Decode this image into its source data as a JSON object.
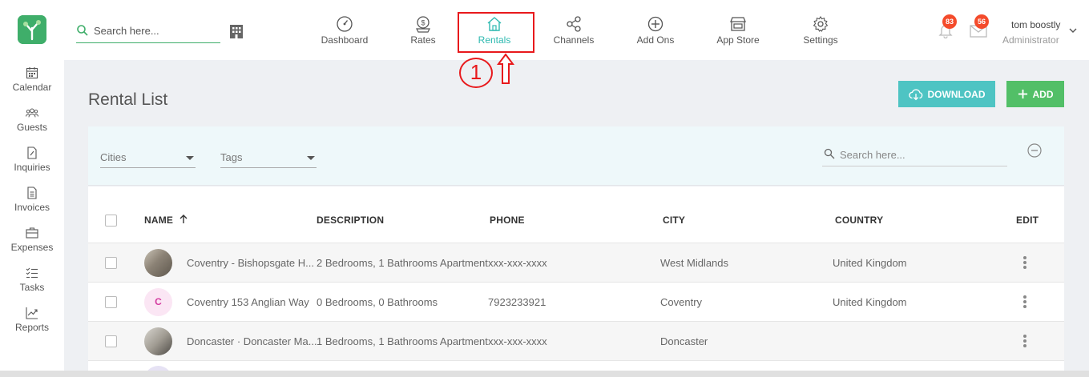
{
  "topbar": {
    "search_placeholder": "Search here...",
    "nav": [
      {
        "label": "Dashboard",
        "icon": "dashboard-icon"
      },
      {
        "label": "Rates",
        "icon": "rates-icon"
      },
      {
        "label": "Rentals",
        "icon": "home-icon",
        "active": true
      },
      {
        "label": "Channels",
        "icon": "share-icon"
      },
      {
        "label": "Add Ons",
        "icon": "plus-circle-icon"
      },
      {
        "label": "App Store",
        "icon": "store-icon"
      },
      {
        "label": "Settings",
        "icon": "gear-icon"
      }
    ],
    "notifications_count": "83",
    "messages_count": "56",
    "user_name": "tom boostly",
    "user_role": "Administrator"
  },
  "annotation": {
    "step": "1",
    "color": "#e8191c"
  },
  "sidebar": {
    "items": [
      {
        "label": "Calendar",
        "icon": "calendar-icon"
      },
      {
        "label": "Guests",
        "icon": "guests-icon"
      },
      {
        "label": "Inquiries",
        "icon": "inquiries-icon"
      },
      {
        "label": "Invoices",
        "icon": "invoices-icon"
      },
      {
        "label": "Expenses",
        "icon": "briefcase-icon"
      },
      {
        "label": "Tasks",
        "icon": "tasks-icon"
      },
      {
        "label": "Reports",
        "icon": "reports-icon"
      }
    ]
  },
  "main": {
    "title": "Rental List",
    "download_label": "DOWNLOAD",
    "add_label": "ADD",
    "filters": {
      "cities_label": "Cities",
      "tags_label": "Tags",
      "search_placeholder": "Search here..."
    },
    "table": {
      "headers": {
        "name": "NAME",
        "description": "DESCRIPTION",
        "phone": "PHONE",
        "city": "CITY",
        "country": "COUNTRY",
        "edit": "EDIT"
      },
      "rows": [
        {
          "avatar": "photo",
          "name": "Coventry - Bishopsgate H...",
          "description": "2 Bedrooms, 1 Bathrooms Apartment",
          "phone": "xxx-xxx-xxxx",
          "city": "West Midlands",
          "country": "United Kingdom"
        },
        {
          "avatar": "C",
          "name": "Coventry 153 Anglian Way",
          "description": "0 Bedrooms, 0 Bathrooms",
          "phone": "7923233921",
          "city": "Coventry",
          "country": "United Kingdom"
        },
        {
          "avatar": "photo",
          "name": "Doncaster · Doncaster Ma...",
          "description": "1 Bedrooms, 1 Bathrooms Apartment",
          "phone": "xxx-xxx-xxxx",
          "city": "Doncaster",
          "country": ""
        }
      ]
    }
  },
  "colors": {
    "brand_green": "#3fae6a",
    "active_teal": "#2eb9b0",
    "download_bg": "#4ec4c3",
    "add_bg": "#52bf67",
    "badge_red": "#f44b2b"
  }
}
